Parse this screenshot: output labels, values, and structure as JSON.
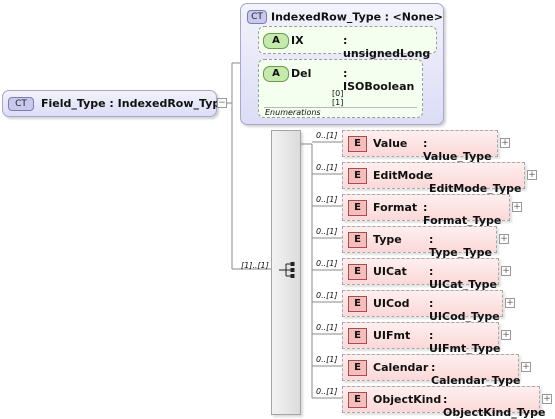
{
  "root": {
    "badge": "CT",
    "label": "Field_Type : IndexedRow_Type"
  },
  "complex_type": {
    "badge": "CT",
    "name": "IndexedRow_Type",
    "colon": ":",
    "base": "<None>",
    "attributes": [
      {
        "badge": "A",
        "name": "IX",
        "type": ": unsignedLong"
      },
      {
        "badge": "A",
        "name": "Del",
        "type": ": ISOBoolean",
        "enumerations_label": "Enumerations",
        "enumerations": [
          "[0]",
          "[1]"
        ]
      }
    ]
  },
  "sequence": {
    "cardinality": "[1]..[1]"
  },
  "elements": [
    {
      "badge": "E",
      "name": "Value",
      "type": ": Value_Type",
      "cardinality": "0..[1]"
    },
    {
      "badge": "E",
      "name": "EditMode",
      "type": ": EditMode_Type",
      "cardinality": "0..[1]"
    },
    {
      "badge": "E",
      "name": "Format",
      "type": ": Format_Type",
      "cardinality": "0..[1]"
    },
    {
      "badge": "E",
      "name": "Type",
      "type": ": Type_Type",
      "cardinality": "0..[1]"
    },
    {
      "badge": "E",
      "name": "UICat",
      "type": ": UICat_Type",
      "cardinality": "0..[1]"
    },
    {
      "badge": "E",
      "name": "UICod",
      "type": ": UICod_Type",
      "cardinality": "0..[1]"
    },
    {
      "badge": "E",
      "name": "UIFmt",
      "type": ": UIFmt_Type",
      "cardinality": "0..[1]"
    },
    {
      "badge": "E",
      "name": "Calendar",
      "type": ": Calendar_Type",
      "cardinality": "0..[1]"
    },
    {
      "badge": "E",
      "name": "ObjectKind",
      "type": ": ObjectKind_Type",
      "cardinality": "0..[1]"
    }
  ]
}
